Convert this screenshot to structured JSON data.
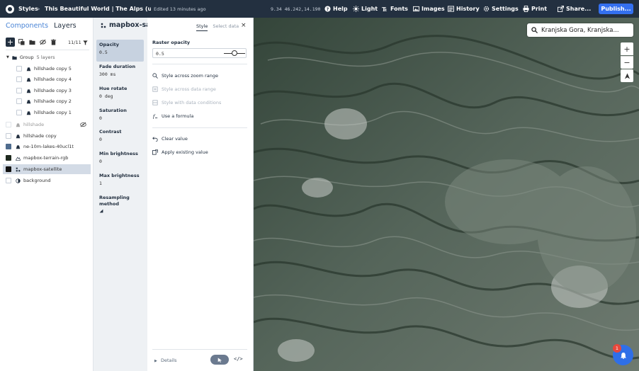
{
  "topbar": {
    "app_label": "Styles",
    "separator": "›",
    "style_title": "This Beautiful World | The Alps (used i...",
    "edited": "Edited 13 minutes ago",
    "coords": "9.34 46.242,14.190",
    "help": "Help",
    "light": "Light",
    "fonts": "Fonts",
    "images": "Images",
    "history": "History",
    "settings": "Settings",
    "print": "Print",
    "share": "Share...",
    "publish": "Publish..."
  },
  "left_panel": {
    "tabs": [
      "Components",
      "Layers"
    ],
    "active_tab": "Layers",
    "count": "11/11",
    "group_name": "Group",
    "group_count": "5 layers",
    "group_layers": [
      "hillshade copy 5",
      "hillshade copy 4",
      "hillshade copy 3",
      "hillshade copy 2",
      "hillshade copy 1"
    ],
    "layers": [
      "hillshade",
      "hillshade copy",
      "ne-10m-lakes-40ucl1t",
      "mapbox-terrain-rgb",
      "mapbox-satellite",
      "background"
    ],
    "selected_layer": "mapbox-satellite"
  },
  "properties": {
    "layer_name": "mapbox-satellite",
    "items": [
      {
        "label": "Opacity",
        "value": "0.5"
      },
      {
        "label": "Fade duration",
        "value": "300 ms"
      },
      {
        "label": "Hue rotate",
        "value": "0 deg"
      },
      {
        "label": "Saturation",
        "value": "0"
      },
      {
        "label": "Contrast",
        "value": "0"
      },
      {
        "label": "Min brightness",
        "value": "0"
      },
      {
        "label": "Max brightness",
        "value": "1"
      },
      {
        "label": "Resampling method",
        "value": ""
      }
    ]
  },
  "editor": {
    "tabs": [
      "Style",
      "Select data"
    ],
    "active_tab": "Style",
    "close": "×",
    "field_label": "Raster opacity",
    "field_value": "0.5",
    "slider_value": 0.5,
    "options": [
      {
        "label": "Style across zoom range",
        "enabled": true
      },
      {
        "label": "Style across data range",
        "enabled": false
      },
      {
        "label": "Style with data conditions",
        "enabled": false
      },
      {
        "label": "Use a formula",
        "enabled": true
      }
    ],
    "actions": [
      "Clear value",
      "Apply existing value"
    ],
    "details": "Details",
    "code": "</>"
  },
  "map": {
    "search_value": "Kranjska Gora, Kranjska...",
    "zoom_in": "+",
    "zoom_out": "−",
    "notification_count": "1"
  },
  "colors": {
    "topbar": "#233040",
    "accent": "#3470f0",
    "selected_row": "#d3dbe6",
    "notification": "#e8473b"
  }
}
